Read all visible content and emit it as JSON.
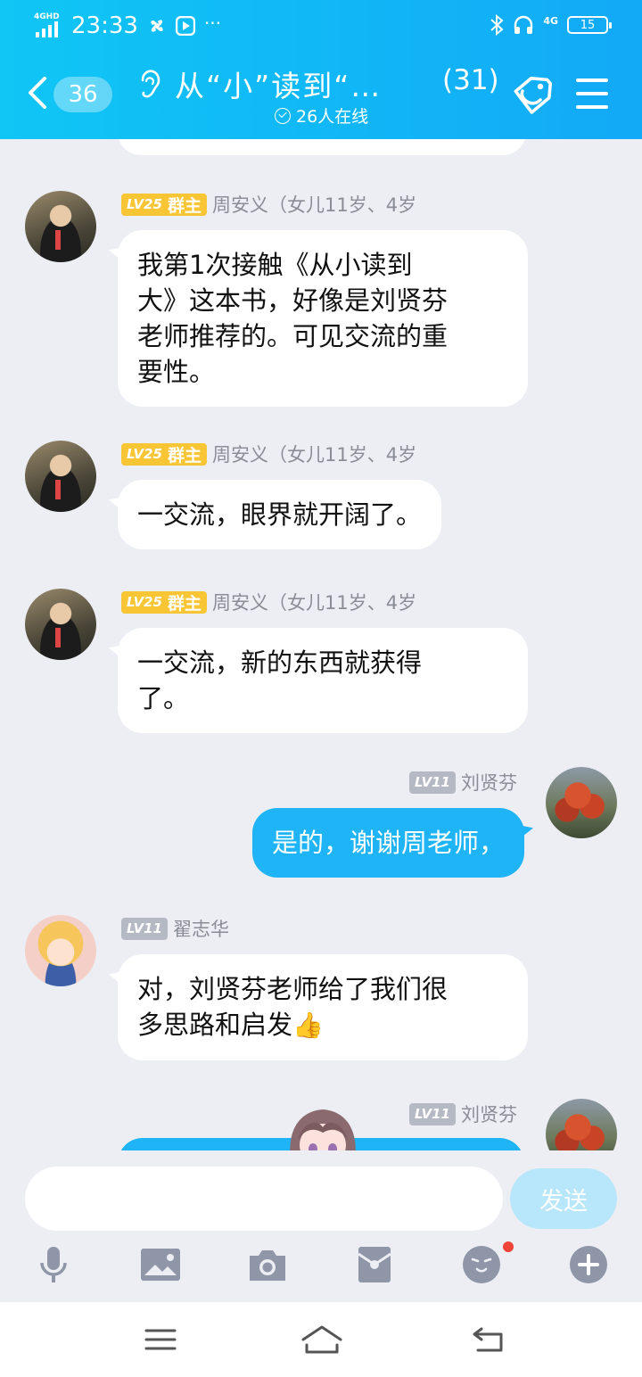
{
  "status_bar": {
    "network_tag": "4GHD",
    "time": "23:33",
    "more": "···",
    "net_right": "4G",
    "battery": "15"
  },
  "header": {
    "unread_count": "36",
    "title": "从“小”读到“…",
    "member_count": "(31)",
    "online": "26人在线"
  },
  "messages": [
    {
      "level": "LV25",
      "role": "群主",
      "sender": "周安义（女儿11岁、4岁",
      "lines": [
        "我第1次接触《从小读到",
        "大》这本书，好像是刘贤芬",
        "老师推荐的。可见交流的重",
        "要性。"
      ],
      "direction": "in"
    },
    {
      "level": "LV25",
      "role": "群主",
      "sender": "周安义（女儿11岁、4岁",
      "lines": [
        "一交流，眼界就开阔了。"
      ],
      "direction": "in"
    },
    {
      "level": "LV25",
      "role": "群主",
      "sender": "周安义（女儿11岁、4岁",
      "lines": [
        "一交流，新的东西就获得",
        "了。"
      ],
      "direction": "in"
    },
    {
      "level": "LV11",
      "sender": "刘贤芬",
      "lines": [
        "是的，谢谢周老师，"
      ],
      "direction": "out"
    },
    {
      "level": "LV11",
      "sender": "翟志华",
      "lines": [
        "对，刘贤芬老师给了我们很",
        "多思路和启发"
      ],
      "emoji": "👍",
      "direction": "in"
    },
    {
      "level": "LV11",
      "sender": "刘贤芬",
      "lines": [],
      "direction": "out"
    }
  ],
  "input": {
    "placeholder": "",
    "send_label": "发送"
  },
  "colors": {
    "header_start": "#10c6f5",
    "header_end": "#12a9f6",
    "outgoing_bubble": "#1fb4f5",
    "owner_badge": "#f8c534",
    "level_badge": "#b5b9c4",
    "send_disabled": "#b8e7fb"
  }
}
